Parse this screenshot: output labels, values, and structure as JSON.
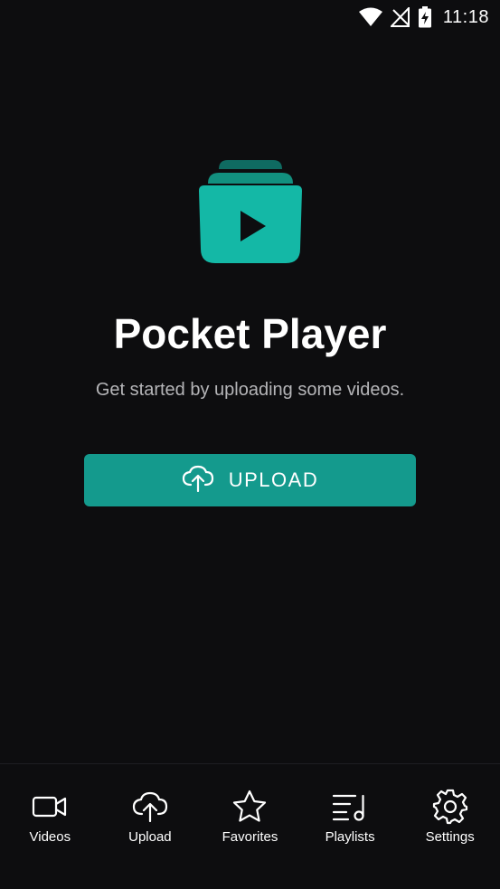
{
  "status_bar": {
    "time": "11:18",
    "icons": [
      "wifi-icon",
      "no-signal-icon",
      "battery-charging-icon"
    ]
  },
  "app": {
    "logo_icon": "video-stack-play-icon",
    "title": "Pocket Player",
    "subtitle": "Get started by uploading some videos."
  },
  "upload_button": {
    "icon": "cloud-upload-icon",
    "label": "UPLOAD"
  },
  "bottom_nav": {
    "items": [
      {
        "label": "Videos",
        "icon": "video-camera-icon"
      },
      {
        "label": "Upload",
        "icon": "cloud-upload-icon"
      },
      {
        "label": "Favorites",
        "icon": "star-icon"
      },
      {
        "label": "Playlists",
        "icon": "playlist-icon"
      },
      {
        "label": "Settings",
        "icon": "gear-icon"
      }
    ]
  },
  "colors": {
    "background": "#0d0d0f",
    "accent": "#149a8d",
    "logo": "#14b8a6",
    "logo_dark": "#0f6b61"
  }
}
